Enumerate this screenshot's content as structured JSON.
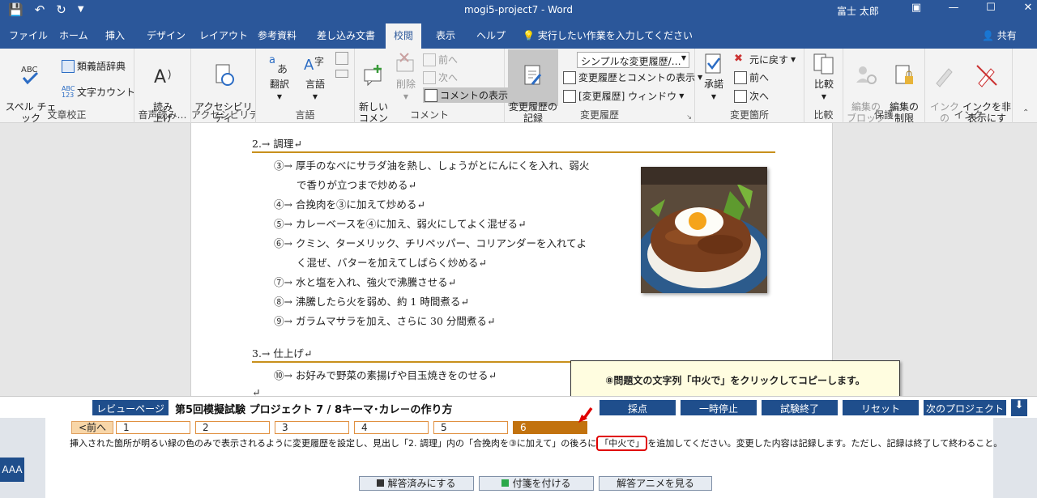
{
  "window": {
    "title": "mogi5-project7  -  Word",
    "user": "富士 太郎"
  },
  "tabs": [
    "ファイル",
    "ホーム",
    "挿入",
    "デザイン",
    "レイアウト",
    "参考資料",
    "差し込み文書",
    "校閲",
    "表示",
    "ヘルプ",
    "実行したい作業を入力してください"
  ],
  "share": "共有",
  "ribbon": {
    "spell": "スペル チェック\nと文章校正",
    "thesaurus": "類義語辞典",
    "wordcount": "文字カウント",
    "g_proofing": "文章校正",
    "readaloud": "読み\n上げ",
    "g_speech": "音声読み…",
    "accessibility": "アクセシビリティ\nチェック",
    "g_access": "アクセシビリティ",
    "translate": "翻訳",
    "language": "言語",
    "g_language": "言語",
    "newcomment": "新しい\nコメント",
    "delete": "削除",
    "prev": "前へ",
    "next": "次へ",
    "showcomments": "コメントの表示",
    "g_comment": "コメント",
    "track": "変更履歴の\n記録",
    "simplemarkup": "シンプルな変更履歴/…",
    "showmarkup": "変更履歴とコメントの表示",
    "reviewpane": "[変更履歴] ウィンドウ",
    "g_track": "変更履歴",
    "accept": "承諾",
    "reject": "元に戻す",
    "prev2": "前へ",
    "next2": "次へ",
    "g_changes": "変更箇所",
    "compare": "比較",
    "g_compare": "比較",
    "block": "編集の\nブロック",
    "restrict": "編集の\n制限",
    "g_protect": "保護",
    "startink": "インクの\n開始",
    "hideink": "インクを非\n表示にする",
    "g_ink": "インク"
  },
  "document": {
    "h2": "2.→ 調理↵",
    "steps": [
      "③→ 厚手のなべにサラダ油を熱し、しょうがとにんにくを入れ、弱火",
      "で香りが立つまで炒める↵",
      "④→ 合挽肉を③に加えて炒める↵",
      "⑤→ カレーベースを④に加え、弱火にしてよく混ぜる↵",
      "⑥→ クミン、ターメリック、チリペッパー、コリアンダーを入れてよ",
      "く混ぜ、バターを加えてしばらく炒める↵",
      "⑦→ 水と塩を入れ、強火で沸騰させる↵",
      "⑧→ 沸騰したら火を弱め、約 1 時間煮る↵",
      "⑨→ ガラムマサラを加え、さらに 30 分間煮る↵"
    ],
    "h3": "3.→ 仕上げ↵",
    "step10": "⑩→ お好みで野菜の素揚げや目玉焼きをのせる↵",
    "trailing": "↵"
  },
  "callout": "⑧問題文の文字列「中火で」をクリックしてコピーします。",
  "exam": {
    "review": "レビューページ",
    "title": "第5回模擬試験 プロジェクト 7 / 8キーマ･カレ－の作り方",
    "grade": "採点",
    "pause": "一時停止",
    "end": "試験終了",
    "reset": "リセット",
    "nextproj": "次のプロジェクト"
  },
  "task": {
    "prev": "<前へ",
    "tabs": [
      "1",
      "2",
      "3",
      "4",
      "5",
      "6"
    ],
    "text_before": "挿入された箇所が明るい緑の色のみで表示されるように変更履歴を設定し、見出し「2. 調理」内の「合挽肉を③に加えて」の後ろに",
    "text_box": "「中火で」",
    "text_after": "を追加してください。変更した内容は記録します。ただし、記録は終了して終わること。",
    "done": "解答済みにする",
    "sticky": "付箋を付ける",
    "anime": "解答アニメを見る",
    "fontsize": "AAA"
  }
}
